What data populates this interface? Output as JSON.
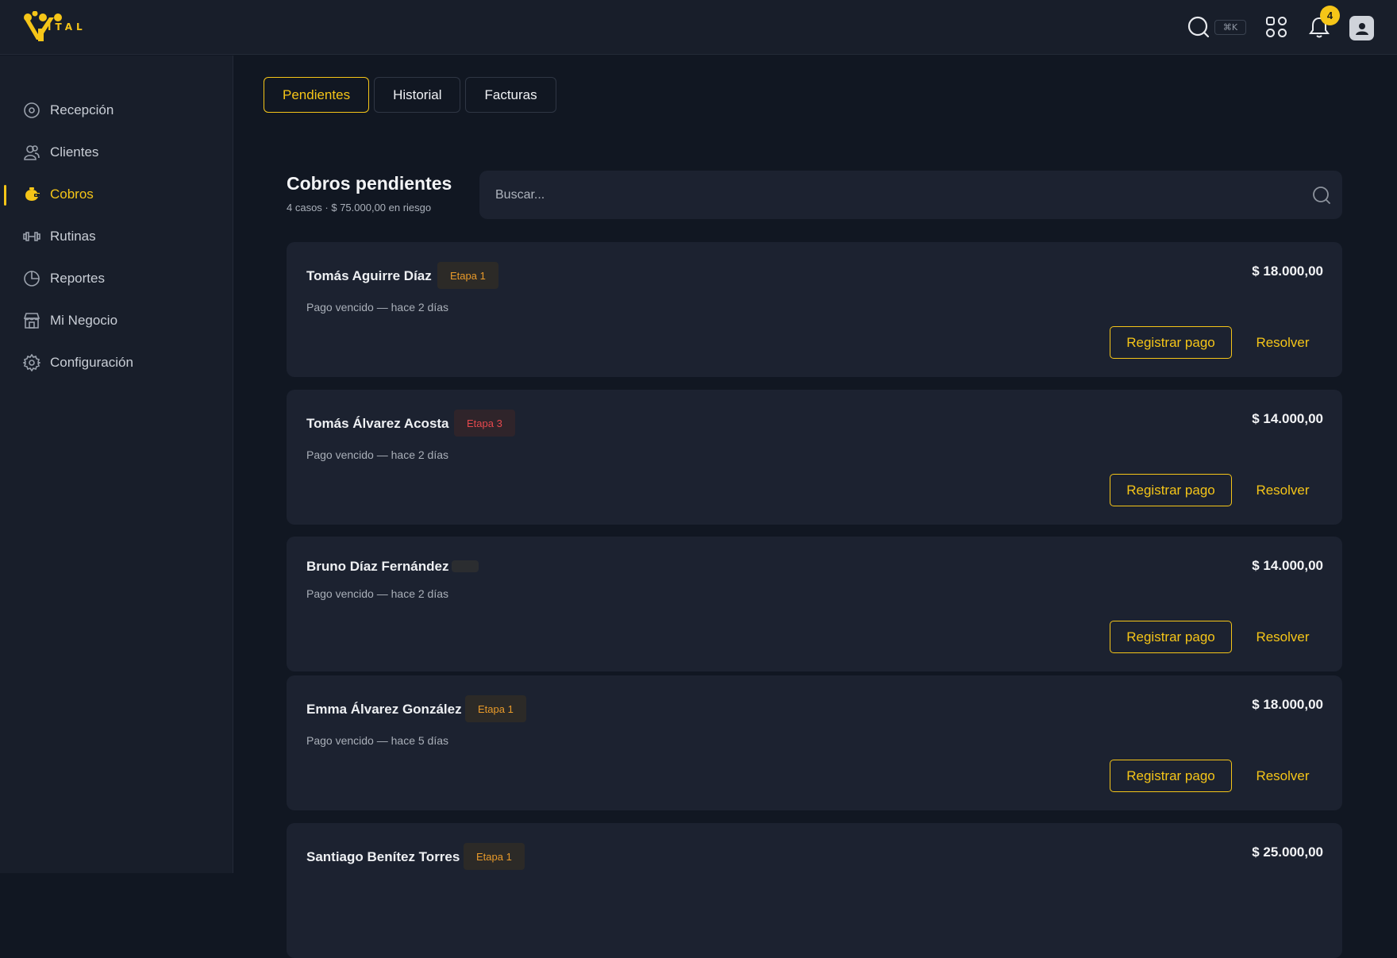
{
  "app": {
    "logo_text": "ITAL"
  },
  "topbar": {
    "shortcut": "⌘K",
    "notifications_count": "4",
    "accent": "#f5c518"
  },
  "sidebar": {
    "items": [
      {
        "label": "Recepción",
        "icon": "reception-icon",
        "active": false
      },
      {
        "label": "Clientes",
        "icon": "clients-icon",
        "active": false
      },
      {
        "label": "Cobros",
        "icon": "piggy-bank-icon",
        "active": true
      },
      {
        "label": "Rutinas",
        "icon": "dumbbell-icon",
        "active": false
      },
      {
        "label": "Reportes",
        "icon": "pie-chart-icon",
        "active": false
      },
      {
        "label": "Mi Negocio",
        "icon": "store-icon",
        "active": false
      },
      {
        "label": "Configuración",
        "icon": "gear-icon",
        "active": false
      }
    ]
  },
  "tabs": [
    {
      "label": "Pendientes",
      "active": true
    },
    {
      "label": "Historial",
      "active": false
    },
    {
      "label": "Facturas",
      "active": false
    }
  ],
  "main": {
    "title": "Cobros pendientes",
    "subtitle": "4 casos · $ 75.000,00 en riesgo",
    "search_placeholder": "Buscar..."
  },
  "actions": {
    "register": "Registrar pago",
    "resolve": "Resolver"
  },
  "cases": [
    {
      "name": "Tomás Aguirre Díaz",
      "stage": "Etapa 1",
      "stage_color": "orange",
      "status": "Pago vencido — hace 2 días",
      "amount": "$ 18.000,00"
    },
    {
      "name": "Tomás Álvarez Acosta",
      "stage": "Etapa 3",
      "stage_color": "red",
      "status": "Pago vencido — hace 2 días",
      "amount": "$ 14.000,00"
    },
    {
      "name": "Bruno Díaz Fernández",
      "stage": "",
      "stage_color": "empty",
      "status": "Pago vencido — hace 2 días",
      "amount": "$ 14.000,00"
    },
    {
      "name": "Emma Álvarez González",
      "stage": "Etapa 1",
      "stage_color": "orange",
      "status": "Pago vencido — hace 5 días",
      "amount": "$ 18.000,00"
    },
    {
      "name": "Santiago Benítez Torres",
      "stage": "Etapa 1",
      "stage_color": "orange",
      "status": "",
      "amount": "$ 25.000,00"
    }
  ]
}
